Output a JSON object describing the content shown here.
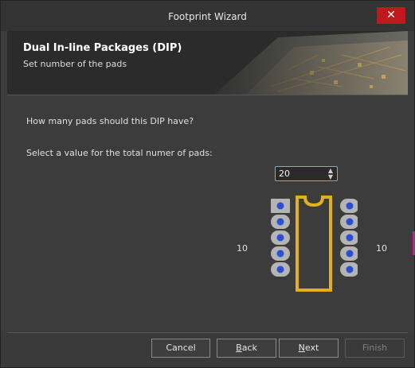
{
  "window": {
    "title": "Footprint Wizard",
    "close_glyph": "✕"
  },
  "header": {
    "title": "Dual In-line Packages (DIP)",
    "subtitle": "Set number of the pads"
  },
  "content": {
    "question": "How many pads should this DIP have?",
    "select_label": "Select a value for the total numer of pads:",
    "pad_total": "20",
    "left_count": "10",
    "right_count": "10",
    "pads_per_side": 5
  },
  "footer": {
    "cancel": "Cancel",
    "back_prefix": "B",
    "back_rest": "ack",
    "next_prefix": "N",
    "next_rest": "ext",
    "finish": "Finish"
  },
  "colors": {
    "pad": "#b4b4b4",
    "pad_hole": "#2a4fd0",
    "body_outline": "#e0b020",
    "close": "#c0191d"
  },
  "icons": {
    "spin_up": "▲",
    "spin_down": "▼"
  }
}
